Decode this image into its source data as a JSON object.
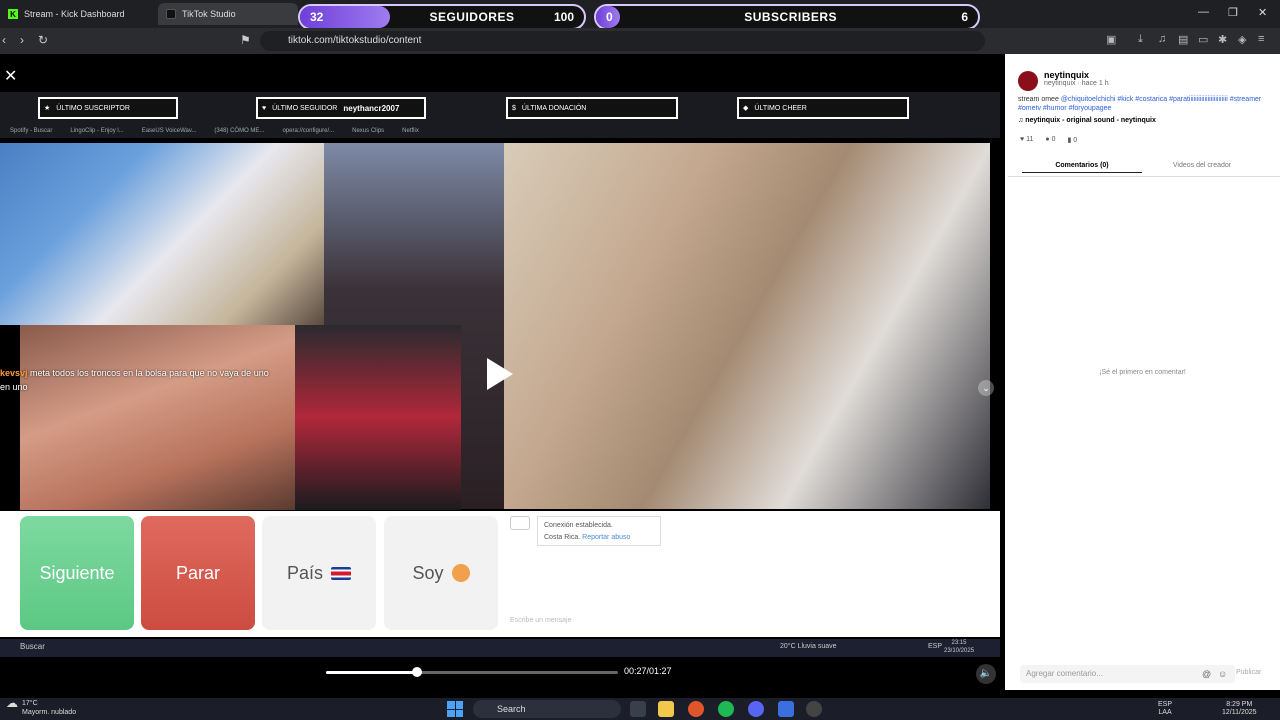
{
  "browser": {
    "tabs": [
      {
        "label": "Stream - Kick Dashboard"
      },
      {
        "label": "TikTok Studio"
      }
    ],
    "url": "tiktok.com/tiktokstudio/content"
  },
  "overlay": {
    "followers": {
      "current": "32",
      "label": "SEGUIDORES",
      "goal": "100"
    },
    "subscribers": {
      "current": "0",
      "label": "SUBSCRIBERS",
      "goal": "6"
    }
  },
  "stream": {
    "widgets": [
      {
        "label": "ÚLTIMO SUSCRIPTOR",
        "value": ""
      },
      {
        "label": "ÚLTIMO SEGUIDOR",
        "value": "neythancr2007"
      },
      {
        "label": "ÚLTIMA DONACIÓN",
        "value": ""
      },
      {
        "label": "ÚLTIMO CHEER",
        "value": ""
      }
    ],
    "bookmarks": [
      "Spotify - Buscar",
      "LingoClip - Enjoy l...",
      "EaseUS VoiceWav...",
      "(348) CÓMO ME...",
      "opera://configure/...",
      "Nexus Clips",
      "Netflix"
    ],
    "chat_user": "kevsvj",
    "chat_message": "meta todos los troncos en la bolsa para que no vaya de uno en uno",
    "buttons": {
      "next": "Siguiente",
      "stop": "Parar",
      "country": "País",
      "me": "Soy"
    },
    "connection_text": "Conexión establecida.",
    "country_text": "Costa Rica.",
    "report_link": "Reportar abuso",
    "message_placeholder": "Escribe un mensaje",
    "inner_taskbar": {
      "search": "Buscar",
      "weather": "20°C Lluvia suave",
      "lang": "ESP",
      "time": "23:15",
      "date": "23/10/2025"
    }
  },
  "player": {
    "time": "00:27/01:27",
    "progress": 0.31
  },
  "sidebar": {
    "username": "neytinquix",
    "meta": "neytinquix · hace 1 h",
    "caption_text": "stream omee",
    "caption_tags": "@chiquitoelchichi #kick #costarica #paratiiiiiiiiiiiiiiiiiiiiiiiii #streamer #ometv #humor #foryoupagee",
    "sound": "♫ neytinquix - original sound - neytinquix",
    "likes": "11",
    "comments": "0",
    "saves": "0",
    "tab_comments": "Comentarios (0)",
    "tab_videos": "Videos del creador",
    "empty_text": "¡Sé el primero en comentar!",
    "comment_placeholder": "Agregar comentario...",
    "publish": "Publicar"
  },
  "taskbar": {
    "weather_temp": "17°C",
    "weather_desc": "Mayorm. nublado",
    "search": "Search",
    "lang": "ESP",
    "lang2": "LAA",
    "time": "8:29 PM",
    "date": "12/11/2025"
  },
  "colors": {
    "accent_purple": "#7b4fe0",
    "next_green": "#6fd495",
    "stop_red": "#d85a4e"
  }
}
